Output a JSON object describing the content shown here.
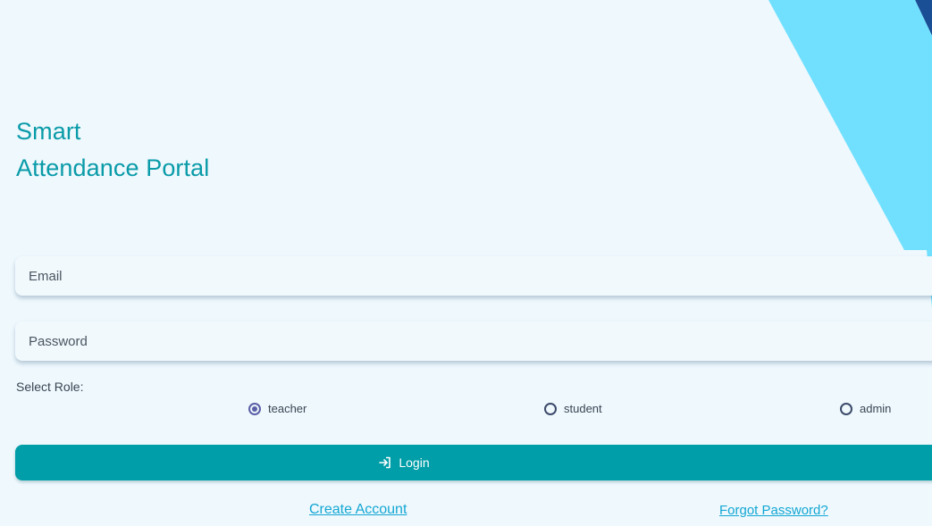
{
  "app": {
    "title_line1": "Smart",
    "title_line2": "Attendance Portal"
  },
  "form": {
    "email": {
      "value": "",
      "placeholder": "Email"
    },
    "password": {
      "value": "",
      "placeholder": "Password"
    },
    "role_label": "Select Role:",
    "roles": [
      {
        "label": "teacher",
        "selected": true
      },
      {
        "label": "student",
        "selected": false
      },
      {
        "label": "admin",
        "selected": false
      }
    ],
    "login_label": "Login",
    "login_icon": "login-icon"
  },
  "links": {
    "create_account": "Create Account",
    "forgot_password": "Forgot Password?"
  },
  "colors": {
    "background": "#eef8fd",
    "title": "#0a9ba8",
    "button": "#009ea8",
    "link": "#13a7d3",
    "decor_light": "#71e0ff",
    "decor_dark": "#1a4f96"
  }
}
